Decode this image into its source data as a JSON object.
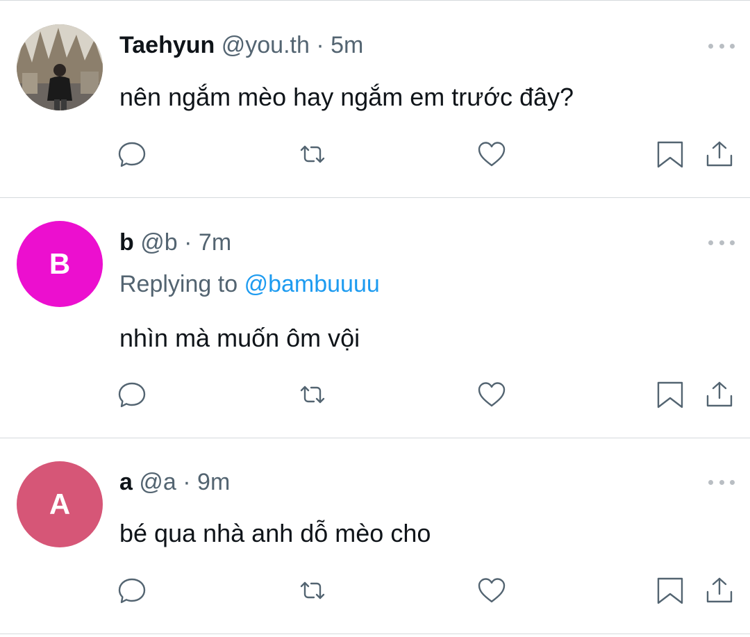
{
  "tweets": [
    {
      "display_name": "Taehyun",
      "handle": "@you.th",
      "separator": "·",
      "time": "5m",
      "text": "nên ngắm mèo hay ngắm em trước đây?",
      "avatar": {
        "type": "photo"
      }
    },
    {
      "display_name": "b",
      "handle": "@b",
      "separator": "·",
      "time": "7m",
      "replying_prefix": "Replying to",
      "replying_to": "@bambuuuu",
      "text": "nhìn mà muốn ôm vội",
      "avatar": {
        "type": "initial",
        "letter": "B",
        "color": "#ec0fcf"
      }
    },
    {
      "display_name": "a",
      "handle": "@a",
      "separator": "·",
      "time": "9m",
      "text": "bé qua nhà anh dỗ mèo cho",
      "avatar": {
        "type": "initial",
        "letter": "A",
        "color": "#d65677"
      }
    }
  ],
  "icons": [
    "reply-icon",
    "retweet-icon",
    "like-icon",
    "bookmark-icon",
    "share-icon",
    "more-icon"
  ],
  "colors": {
    "text": "#0f1419",
    "secondary": "#536471",
    "mention": "#1d9bf0",
    "divider": "#d5d9dc"
  }
}
